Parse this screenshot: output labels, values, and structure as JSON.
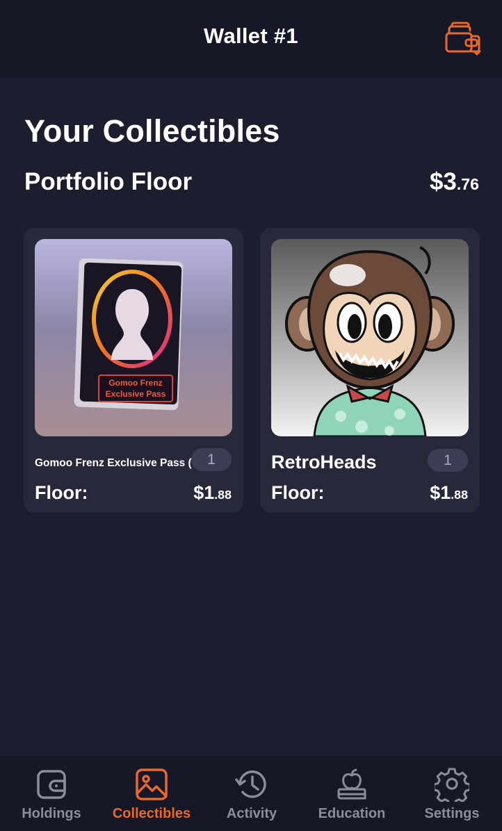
{
  "header": {
    "title": "Wallet #1",
    "wallets_icon": "wallets-stack-icon",
    "accent_color": "#e8692b"
  },
  "page": {
    "heading": "Your Collectibles",
    "portfolio_floor_label": "Portfolio Floor",
    "portfolio_floor_dollars": "$3",
    "portfolio_floor_cents": ".76"
  },
  "collectibles": [
    {
      "name": "Gomoo Frenz Exclusive Pass (GFEP)",
      "count": "1",
      "floor_label": "Floor:",
      "floor_dollars": "$1",
      "floor_cents": ".88",
      "image_text_line1": "Gomoo Frenz",
      "image_text_line2": "Exclusive Pass"
    },
    {
      "name": "RetroHeads",
      "count": "1",
      "floor_label": "Floor:",
      "floor_dollars": "$1",
      "floor_cents": ".88"
    }
  ],
  "nav": {
    "items": [
      {
        "label": "Holdings",
        "icon": "wallet-icon",
        "active": false
      },
      {
        "label": "Collectibles",
        "icon": "image-icon",
        "active": true
      },
      {
        "label": "Activity",
        "icon": "history-icon",
        "active": false
      },
      {
        "label": "Education",
        "icon": "apple-books-icon",
        "active": false
      },
      {
        "label": "Settings",
        "icon": "gear-icon",
        "active": false
      }
    ]
  }
}
